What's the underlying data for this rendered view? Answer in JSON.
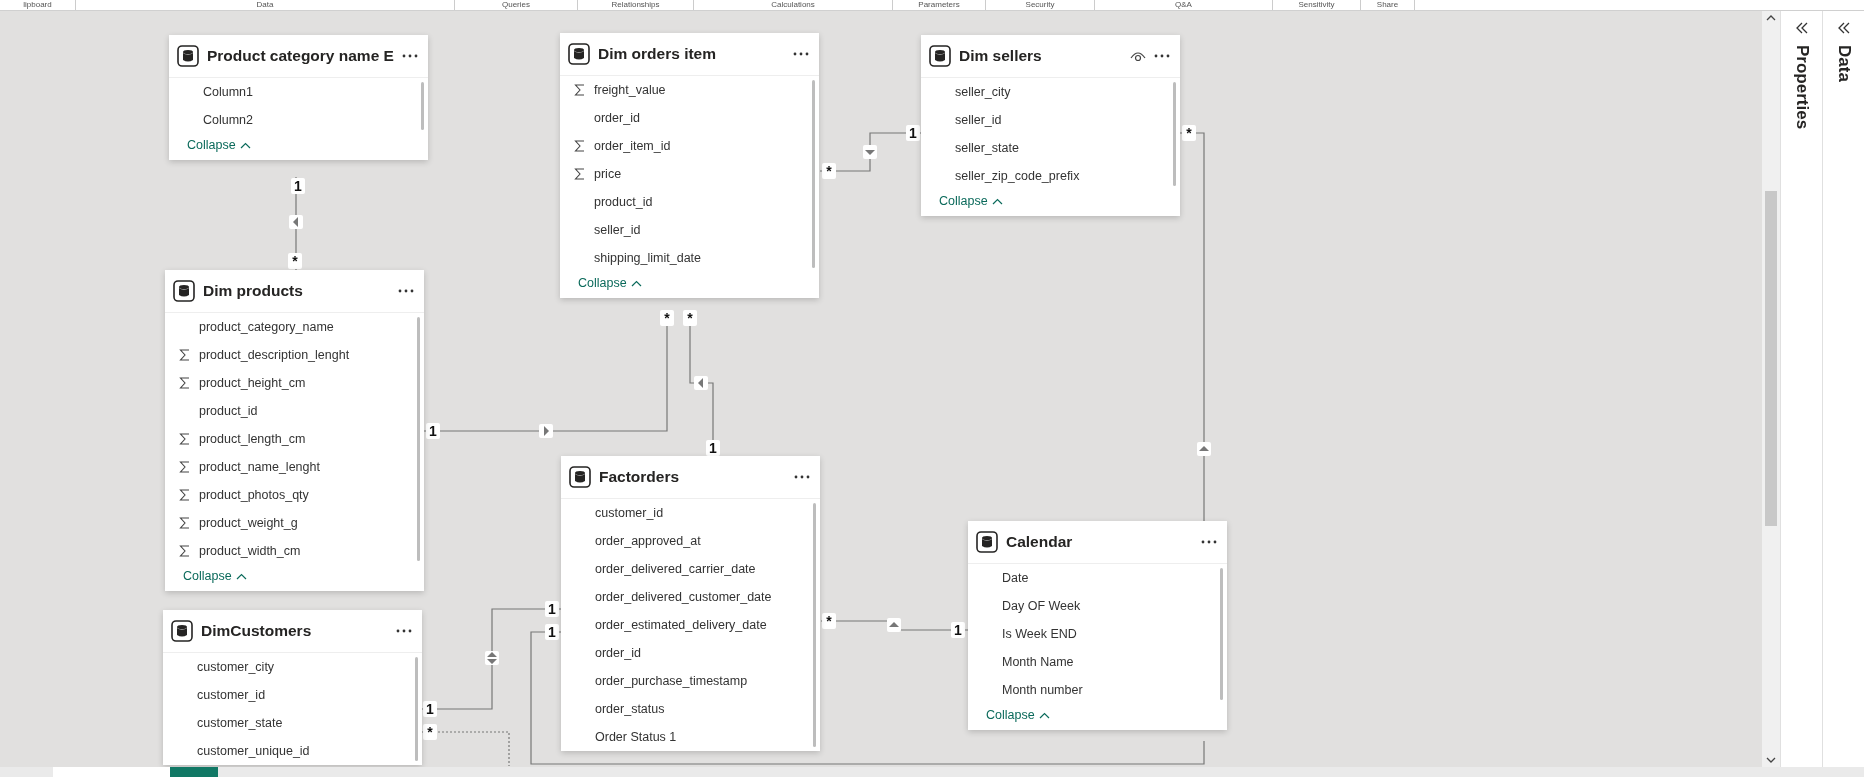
{
  "ribbon_groups": [
    "lipboard",
    "Data",
    "Queries",
    "Relationships",
    "Calculations",
    "Parameters",
    "Security",
    "Q&A",
    "Sensitivity",
    "Share"
  ],
  "tables": [
    {
      "name": "Product category name E",
      "show_eye": false,
      "collapse": "Collapse",
      "columns": [
        {
          "name": "Column1",
          "kind": "column"
        },
        {
          "name": "Column2",
          "kind": "column"
        }
      ]
    },
    {
      "name": "Dim orders item",
      "show_eye": false,
      "collapse": "Collapse",
      "columns": [
        {
          "name": "freight_value",
          "kind": "sum"
        },
        {
          "name": "order_id",
          "kind": "column"
        },
        {
          "name": "order_item_id",
          "kind": "sum"
        },
        {
          "name": "price",
          "kind": "sum"
        },
        {
          "name": "product_id",
          "kind": "column"
        },
        {
          "name": "seller_id",
          "kind": "column"
        },
        {
          "name": "shipping_limit_date",
          "kind": "column"
        }
      ]
    },
    {
      "name": "Dim sellers",
      "show_eye": true,
      "collapse": "Collapse",
      "columns": [
        {
          "name": "seller_city",
          "kind": "column"
        },
        {
          "name": "seller_id",
          "kind": "column"
        },
        {
          "name": "seller_state",
          "kind": "column"
        },
        {
          "name": "seller_zip_code_prefix",
          "kind": "column"
        }
      ]
    },
    {
      "name": "Dim products",
      "show_eye": false,
      "collapse": "Collapse",
      "columns": [
        {
          "name": "product_category_name",
          "kind": "column"
        },
        {
          "name": "product_description_lenght",
          "kind": "sum"
        },
        {
          "name": "product_height_cm",
          "kind": "sum"
        },
        {
          "name": "product_id",
          "kind": "column"
        },
        {
          "name": "product_length_cm",
          "kind": "sum"
        },
        {
          "name": "product_name_lenght",
          "kind": "sum"
        },
        {
          "name": "product_photos_qty",
          "kind": "sum"
        },
        {
          "name": "product_weight_g",
          "kind": "sum"
        },
        {
          "name": "product_width_cm",
          "kind": "sum"
        }
      ]
    },
    {
      "name": "DimCustomers",
      "show_eye": false,
      "columns": [
        {
          "name": "customer_city",
          "kind": "column"
        },
        {
          "name": "customer_id",
          "kind": "column"
        },
        {
          "name": "customer_state",
          "kind": "column"
        },
        {
          "name": "customer_unique_id",
          "kind": "column"
        }
      ]
    },
    {
      "name": "Factorders",
      "show_eye": false,
      "columns": [
        {
          "name": "customer_id",
          "kind": "column"
        },
        {
          "name": "order_approved_at",
          "kind": "column"
        },
        {
          "name": "order_delivered_carrier_date",
          "kind": "column"
        },
        {
          "name": "order_delivered_customer_date",
          "kind": "column"
        },
        {
          "name": "order_estimated_delivery_date",
          "kind": "column"
        },
        {
          "name": "order_id",
          "kind": "column"
        },
        {
          "name": "order_purchase_timestamp",
          "kind": "column"
        },
        {
          "name": "order_status",
          "kind": "column"
        },
        {
          "name": "Order Status 1",
          "kind": "column"
        }
      ]
    },
    {
      "name": "Calendar",
      "show_eye": false,
      "collapse": "Collapse",
      "columns": [
        {
          "name": "Date",
          "kind": "column"
        },
        {
          "name": "Day OF Week",
          "kind": "column"
        },
        {
          "name": "Is Week END",
          "kind": "column"
        },
        {
          "name": "Month Name",
          "kind": "column"
        },
        {
          "name": "Month number",
          "kind": "column"
        }
      ]
    }
  ],
  "relationships": [
    {
      "labels": [
        "1",
        "*"
      ],
      "kind": "single",
      "active": true
    },
    {
      "labels": [
        "1",
        "*"
      ],
      "kind": "single",
      "active": true
    },
    {
      "labels": [
        "*",
        "1"
      ],
      "kind": "single",
      "active": true
    },
    {
      "labels": [
        "*",
        "1"
      ],
      "kind": "single",
      "active": true
    },
    {
      "labels": [
        "*"
      ],
      "kind": "single",
      "active": true
    },
    {
      "labels": [
        "*",
        "1"
      ],
      "kind": "single",
      "active": true
    },
    {
      "labels": [
        "1",
        "1"
      ],
      "kind": "both",
      "active": true
    },
    {
      "labels": [
        "1"
      ],
      "active": true
    },
    {
      "labels": [
        "*"
      ],
      "active": false
    }
  ],
  "panels": [
    "Properties",
    "Data"
  ]
}
